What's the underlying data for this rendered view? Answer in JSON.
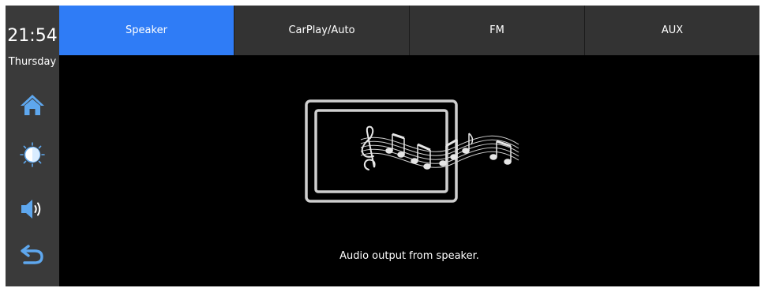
{
  "status": {
    "time": "21:54",
    "day": "Thursday"
  },
  "sidebar": {
    "buttons": [
      {
        "icon": "home-icon"
      },
      {
        "icon": "brightness-icon"
      },
      {
        "icon": "volume-icon"
      },
      {
        "icon": "back-icon"
      }
    ]
  },
  "tabs": [
    {
      "label": "Speaker",
      "active": true
    },
    {
      "label": "CarPlay/Auto",
      "active": false
    },
    {
      "label": "FM",
      "active": false
    },
    {
      "label": "AUX",
      "active": false
    }
  ],
  "main": {
    "caption": "Audio output from speaker."
  },
  "colors": {
    "active_tab": "#2f7cf6",
    "icon_blue": "#5ea7ee",
    "sidebar_bg": "#3a3a3a",
    "tab_bg": "#333333"
  }
}
